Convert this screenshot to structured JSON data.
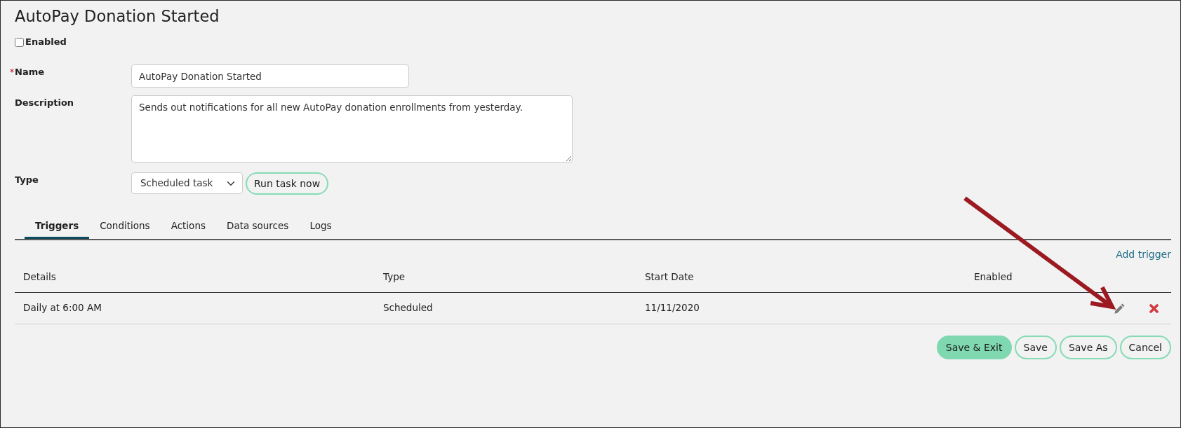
{
  "title": "AutoPay Donation Started",
  "enabled": {
    "label": "Enabled",
    "checked": false
  },
  "fields": [
    {
      "kind": "text",
      "label": "Name",
      "required_mark": "*",
      "value": "AutoPay Donation Started"
    },
    {
      "kind": "textarea",
      "label": "Description",
      "value": "Sends out notifications for all new AutoPay donation enrollments from yesterday."
    },
    {
      "kind": "select",
      "label": "Type",
      "value": "Scheduled task",
      "button": "Run task now"
    }
  ],
  "tabs": [
    {
      "label": "Triggers",
      "selected": true
    },
    {
      "label": "Conditions",
      "selected": false
    },
    {
      "label": "Actions",
      "selected": false
    },
    {
      "label": "Data sources",
      "selected": false
    },
    {
      "label": "Logs",
      "selected": false
    }
  ],
  "add_link": "Add trigger",
  "table": {
    "columns": [
      "Details",
      "Type",
      "Start Date",
      "Enabled"
    ],
    "rows": [
      {
        "cells": [
          "Daily at 6:00 AM",
          "Scheduled",
          "11/11/2020"
        ]
      }
    ]
  },
  "buttons": [
    {
      "label": "Save & Exit",
      "kind": "filled"
    },
    {
      "label": "Save",
      "kind": "outline"
    },
    {
      "label": "Save As",
      "kind": "outline"
    },
    {
      "label": "Cancel",
      "kind": "outline"
    }
  ]
}
